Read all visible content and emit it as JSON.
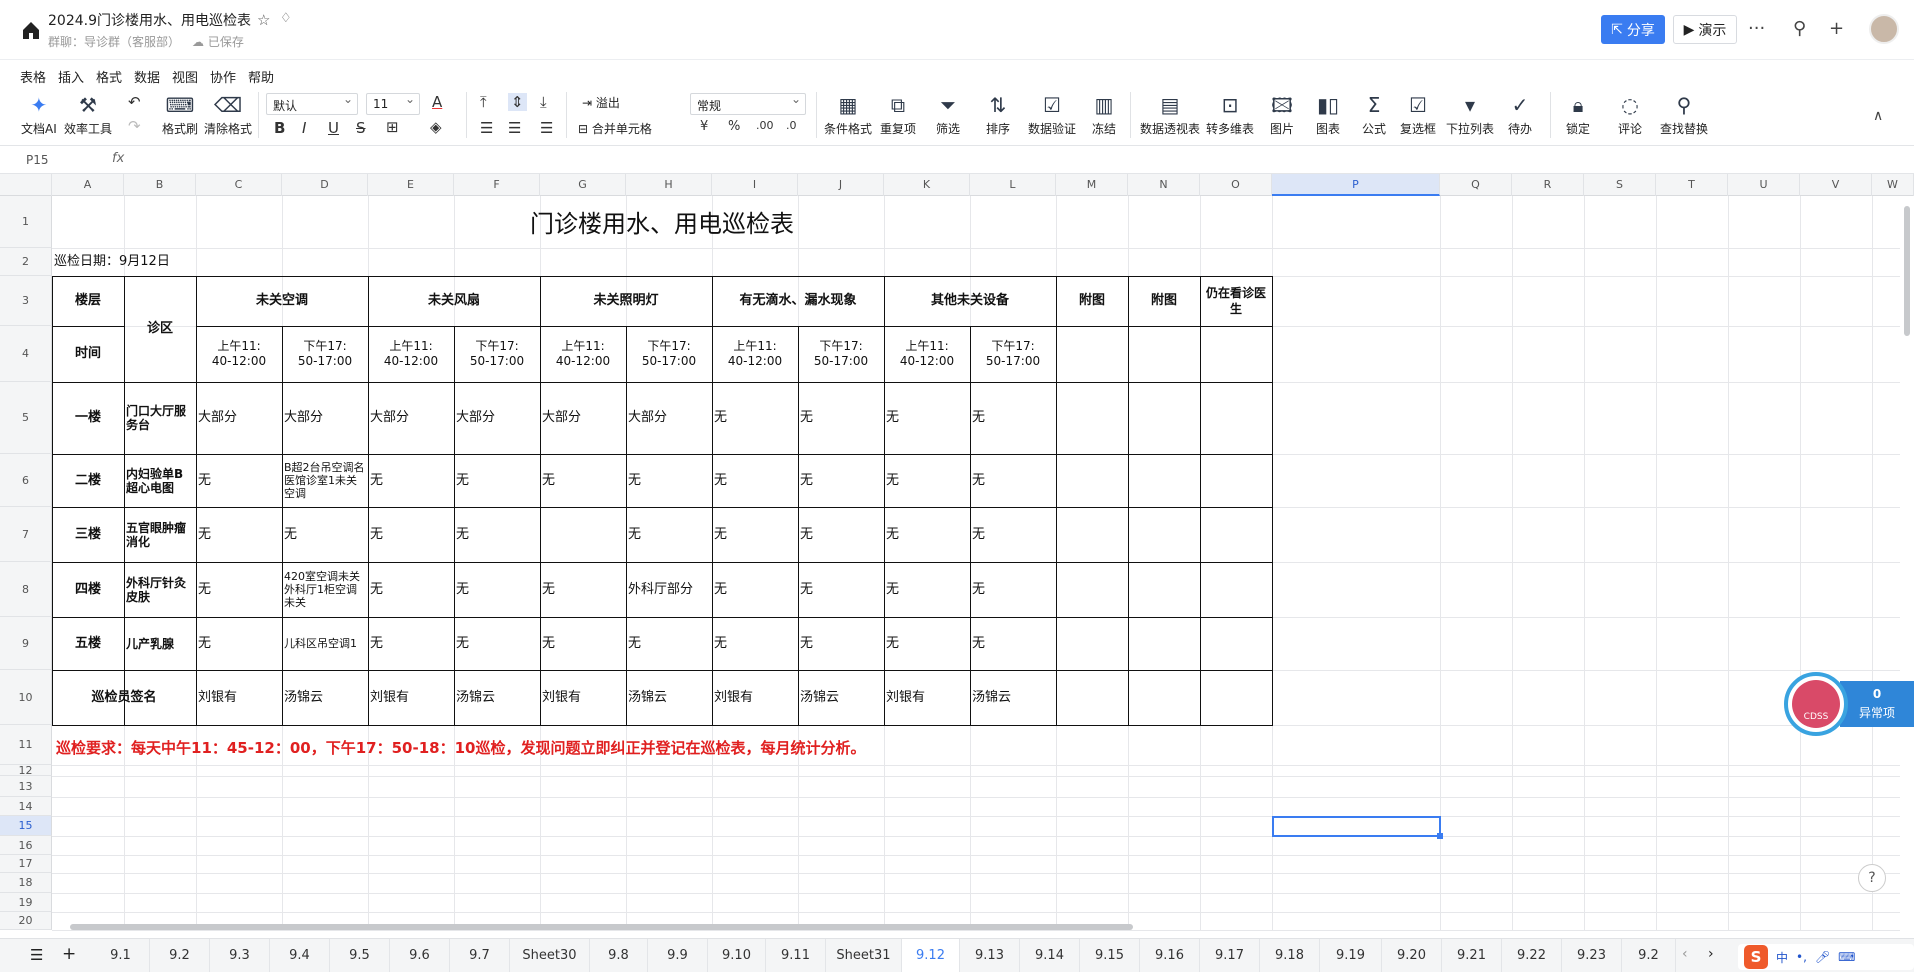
{
  "titlebar": {
    "title": "2024.9门诊楼用水、用电巡检表",
    "subtitle": "群聊：导诊群（客服部）",
    "saved": "已保存",
    "share": "分享",
    "present": "演示"
  },
  "menu": [
    "表格",
    "插入",
    "格式",
    "数据",
    "视图",
    "协作",
    "帮助"
  ],
  "ribbon": {
    "ai": "文档AI",
    "effect": "效率工具",
    "format_painter": "格式刷",
    "clear_format": "清除格式",
    "font": "默认",
    "size": "11",
    "overflow": "溢出",
    "merge": "合并单元格",
    "numfmt": "常规",
    "cond": "条件格式",
    "dup": "重复项",
    "filter": "筛选",
    "sort": "排序",
    "validate": "数据验证",
    "freeze": "冻结",
    "pivot": "数据透视表",
    "wps_table": "转多维表",
    "picture": "图片",
    "chart": "图表",
    "formula": "公式",
    "checkbox": "复选框",
    "dropdown": "下拉列表",
    "todo": "待办",
    "lock": "锁定",
    "comment": "评论",
    "find": "查找替换",
    "currency": "¥",
    "percent": "%",
    "dec_up": ".00",
    "dec_down": ".0"
  },
  "formula": {
    "cellref": "P15",
    "fx": "fx"
  },
  "columns": [
    "A",
    "B",
    "C",
    "D",
    "E",
    "F",
    "G",
    "H",
    "I",
    "J",
    "K",
    "L",
    "M",
    "N",
    "O",
    "P",
    "Q",
    "R",
    "S",
    "T",
    "U",
    "V",
    "W"
  ],
  "rows": [
    "1",
    "2",
    "3",
    "4",
    "5",
    "6",
    "7",
    "8",
    "9",
    "10",
    "11",
    "12",
    "13",
    "14",
    "15",
    "16",
    "17",
    "18",
    "19",
    "20"
  ],
  "sheet": {
    "title": "门诊楼用水、用电巡检表",
    "date": "巡检日期：9月12日",
    "h_floor": "楼层",
    "h_time": "时间",
    "h_dept": "诊区",
    "groups": [
      "未关空调",
      "未关风扇",
      "未关照明灯",
      "有无滴水、漏水现象",
      "其他未关设备"
    ],
    "h_fig1": "附图",
    "h_fig2": "附图",
    "h_doctor": "仍在看诊医生",
    "am": "上午11:\n40-12:00",
    "pm": "下午17:\n50-17:00",
    "rows": [
      {
        "floor": "一楼",
        "dept": "门口大厅服务台",
        "vals": [
          "大部分",
          "大部分",
          "大部分",
          "大部分",
          "大部分",
          "大部分",
          "无",
          "无",
          "无",
          "无"
        ]
      },
      {
        "floor": "二楼",
        "dept": "内妇验单B超心电图",
        "vals": [
          "无",
          "B超2台吊空调名医馆诊室1未关空调",
          "无",
          "无",
          "无",
          "无",
          "无",
          "无",
          "无",
          "无"
        ]
      },
      {
        "floor": "三楼",
        "dept": "五官眼肿瘤消化",
        "vals": [
          "无",
          "无",
          "无",
          "无",
          "",
          "无",
          "无",
          "无",
          "无",
          "无"
        ]
      },
      {
        "floor": "四楼",
        "dept": "外科厅针灸皮肤",
        "vals": [
          "无",
          "420室空调未关外科厅1柜空调未关",
          "无",
          "无",
          "无",
          "外科厅部分",
          "无",
          "无",
          "无",
          "无"
        ]
      },
      {
        "floor": "五楼",
        "dept": "儿产乳腺",
        "vals": [
          "无",
          "儿科区吊空调1",
          "无",
          "无",
          "无",
          "无",
          "无",
          "无",
          "无",
          "无"
        ]
      }
    ],
    "sign_label": "巡检员签名",
    "signs": [
      "刘银有",
      "汤锦云",
      "刘银有",
      "汤锦云",
      "刘银有",
      "汤锦云",
      "刘银有",
      "汤锦云",
      "刘银有",
      "汤锦云"
    ],
    "notice": "巡检要求：每天中午11：45-12：00，下午17：50-18：10巡检，发现问题立即纠正并登记在巡检表，每月统计分析。"
  },
  "tabs": [
    "9.1",
    "9.2",
    "9.3",
    "9.4",
    "9.5",
    "9.6",
    "9.7",
    "Sheet30",
    "9.8",
    "9.9",
    "9.10",
    "9.11",
    "Sheet31",
    "9.12",
    "9.13",
    "9.14",
    "9.15",
    "9.16",
    "9.17",
    "9.18",
    "9.19",
    "9.20",
    "9.21",
    "9.22",
    "9.23",
    "9.2"
  ],
  "active_tab": "9.12",
  "widget": {
    "badge": "CDSS",
    "count": "0",
    "label": "异常项"
  },
  "ime": {
    "logo": "S",
    "lang": "中"
  },
  "colors": {
    "accent": "#3a7cf1",
    "notice": "#e02020",
    "widget": "#2f86d8"
  }
}
